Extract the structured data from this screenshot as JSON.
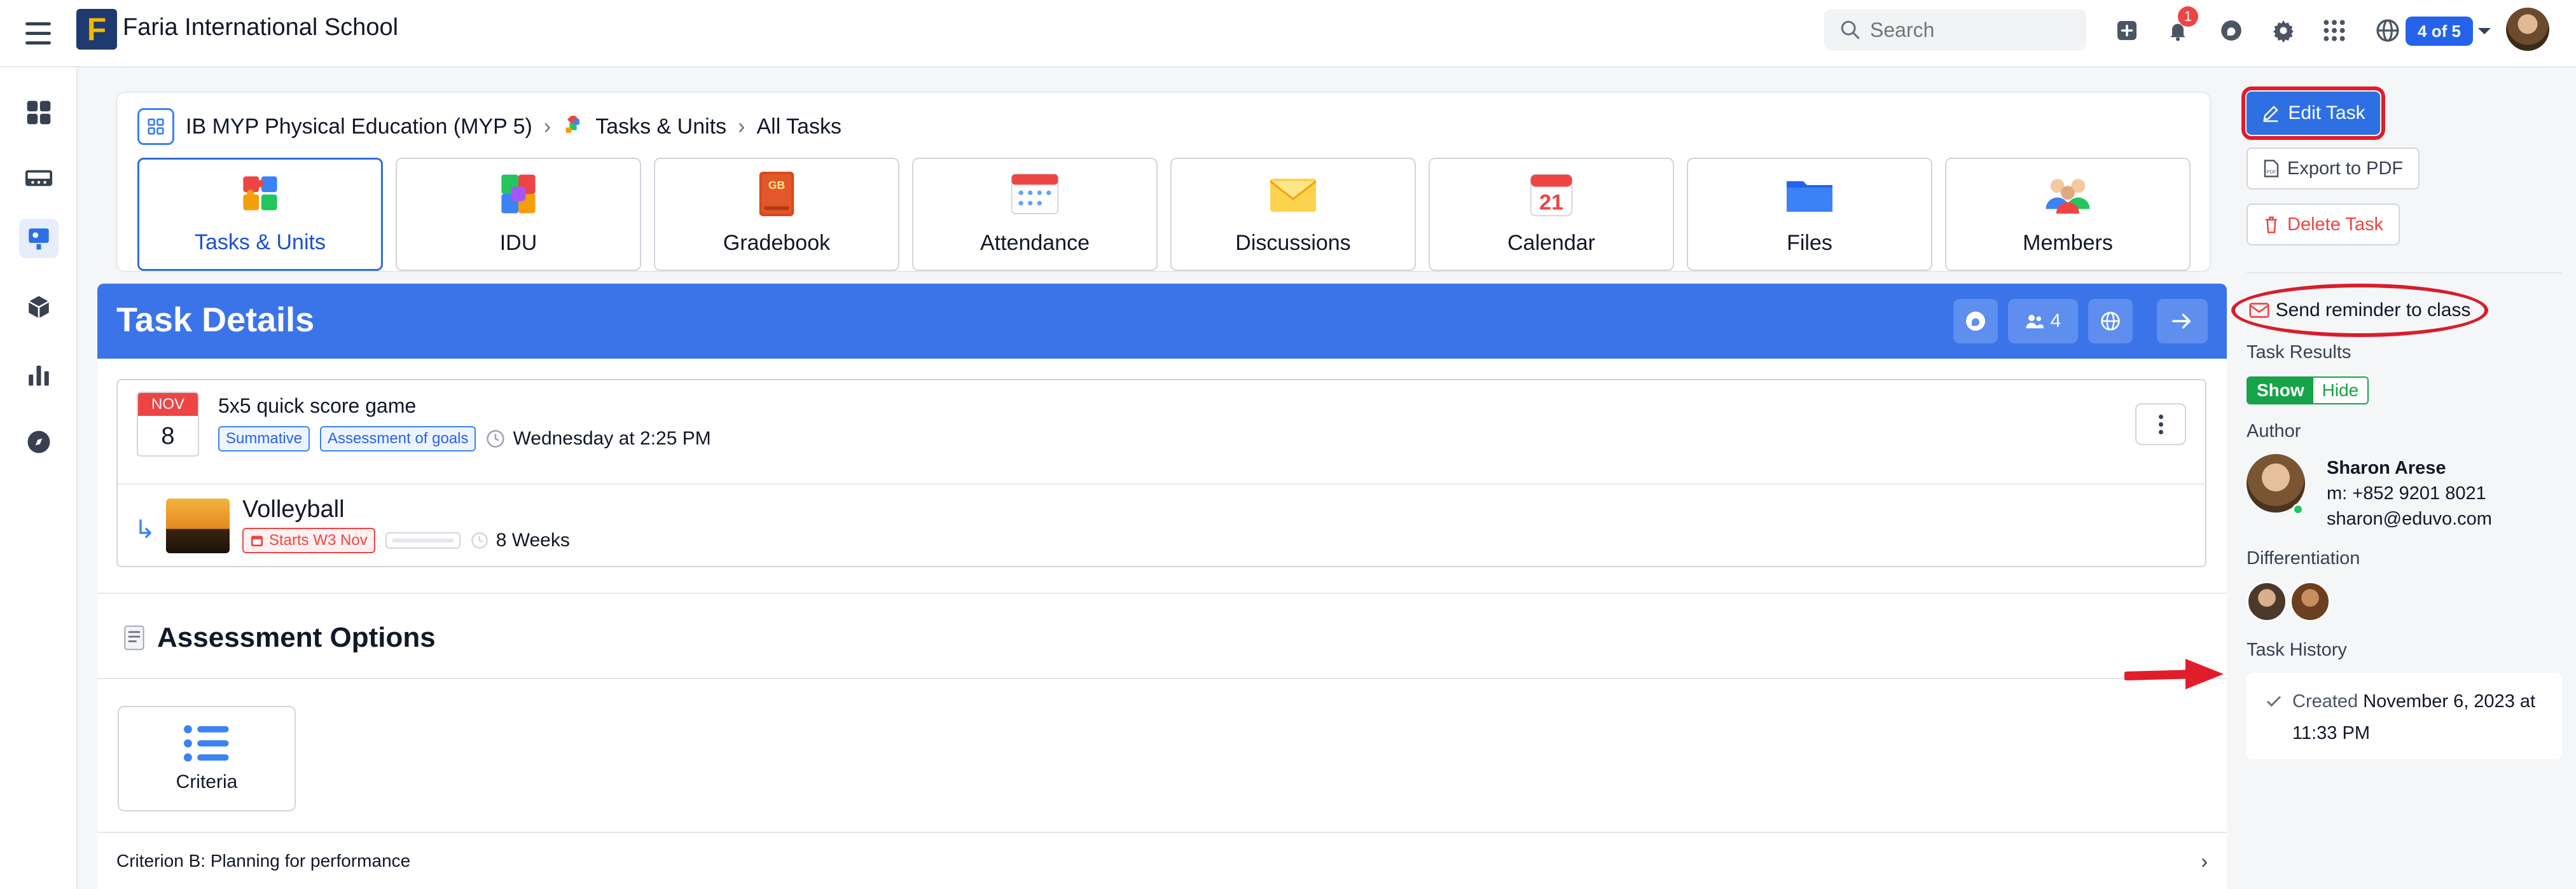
{
  "topbar": {
    "school_name": "Faria International School",
    "logo_letter": "F",
    "search_placeholder": "Search",
    "notification_count": "1",
    "class_switch": "4 of 5"
  },
  "sidebar": {
    "items": [
      {
        "icon": "dashboard-icon"
      },
      {
        "icon": "classes-icon"
      },
      {
        "icon": "teaching-icon",
        "active": true
      },
      {
        "icon": "cube-icon"
      },
      {
        "icon": "analytics-icon"
      },
      {
        "icon": "compass-icon"
      }
    ]
  },
  "breadcrumb": {
    "course": "IB MYP Physical Education (MYP 5)",
    "section": "Tasks & Units",
    "page": "All Tasks"
  },
  "tabs": [
    {
      "label": "Tasks & Units",
      "icon": "puzzle-icon",
      "active": true
    },
    {
      "label": "IDU",
      "icon": "idu-puzzle-icon"
    },
    {
      "label": "Gradebook",
      "icon": "gradebook-icon"
    },
    {
      "label": "Attendance",
      "icon": "attendance-icon"
    },
    {
      "label": "Discussions",
      "icon": "envelope-icon"
    },
    {
      "label": "Calendar",
      "icon": "calendar-icon",
      "day": "21"
    },
    {
      "label": "Files",
      "icon": "folder-icon"
    },
    {
      "label": "Members",
      "icon": "members-icon"
    }
  ],
  "details": {
    "title": "Task Details",
    "members_count": "4",
    "task": {
      "month": "NOV",
      "day": "8",
      "name": "5x5 quick score game",
      "tags": [
        "Summative",
        "Assessment of goals"
      ],
      "due": "Wednesday at 2:25 PM"
    },
    "unit": {
      "name": "Volleyball",
      "starts": "Starts W3 Nov",
      "duration": "8 Weeks"
    },
    "assessment_options_title": "Assessment Options",
    "criteria_label": "Criteria",
    "criterion_row": "Criterion B: Planning for performance"
  },
  "right_panel": {
    "edit_label": "Edit Task",
    "export_label": "Export to PDF",
    "delete_label": "Delete Task",
    "reminder_label": "Send reminder to class",
    "task_results_label": "Task Results",
    "show_label": "Show",
    "hide_label": "Hide",
    "author_label": "Author",
    "author_name": "Sharon Arese",
    "author_phone": "m: +852 9201 8021",
    "author_email": "sharon@eduvo.com",
    "differentiation_label": "Differentiation",
    "task_history_label": "Task History",
    "history_created": "Created",
    "history_date": "November 6, 2023 at",
    "history_time": "11:33 PM"
  },
  "colors": {
    "primary": "#3b74e8",
    "annotation_red": "#d81e2a",
    "success": "#16a34a",
    "danger": "#ef4444"
  }
}
